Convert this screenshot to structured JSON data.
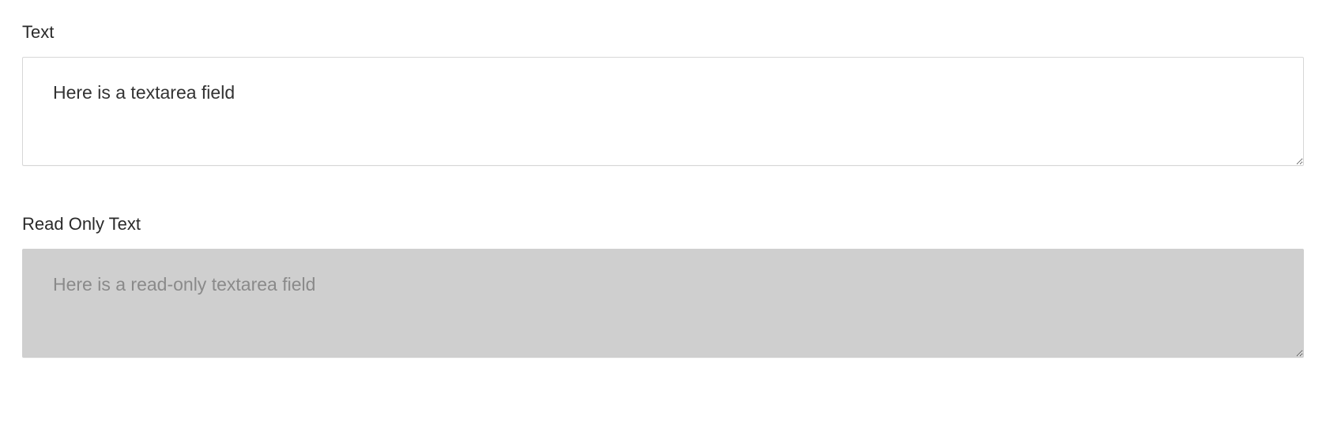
{
  "form": {
    "text": {
      "label": "Text",
      "value": "Here is a textarea field"
    },
    "readonly_text": {
      "label": "Read Only Text",
      "value": "Here is a read-only textarea field"
    }
  }
}
